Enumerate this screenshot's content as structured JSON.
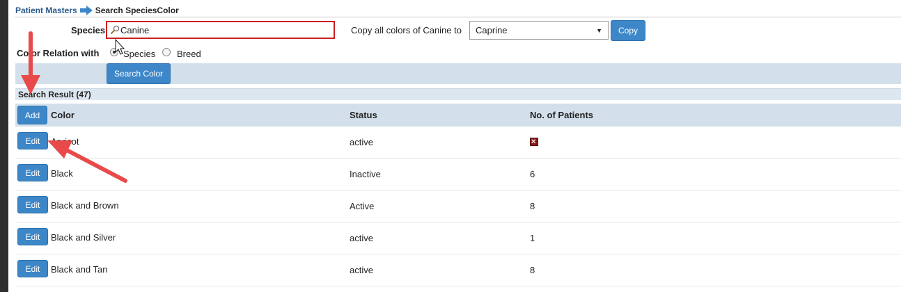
{
  "breadcrumb": {
    "parent": "Patient Masters",
    "current": "Search SpeciesColor"
  },
  "filters": {
    "species_label": "Species",
    "species_value": "Canine",
    "copy_label": "Copy all colors of Canine to",
    "copy_target": "Caprine",
    "copy_button": "Copy",
    "relation_label": "Color Relation with",
    "relation_options": [
      {
        "label": "Species",
        "checked": true
      },
      {
        "label": "Breed",
        "checked": false
      }
    ],
    "search_button": "Search Color"
  },
  "results": {
    "heading": "Search Result (47)",
    "add_button": "Add",
    "columns": {
      "color": "Color",
      "status": "Status",
      "patients": "No. of Patients"
    },
    "edit_label": "Edit",
    "rows": [
      {
        "color": "Apricot",
        "status": "active",
        "patients": "",
        "patients_icon": "red-x-checkbox-icon"
      },
      {
        "color": "Black",
        "status": "Inactive",
        "patients": "6"
      },
      {
        "color": "Black and Brown",
        "status": "Active",
        "patients": "8"
      },
      {
        "color": "Black and Silver",
        "status": "active",
        "patients": "1"
      },
      {
        "color": "Black and Tan",
        "status": "active",
        "patients": "8"
      }
    ]
  },
  "colors": {
    "accent": "#3d87c9",
    "band": "#d3e0ec",
    "annotation": "#e84a4a",
    "error_border": "#cc1f1f"
  }
}
